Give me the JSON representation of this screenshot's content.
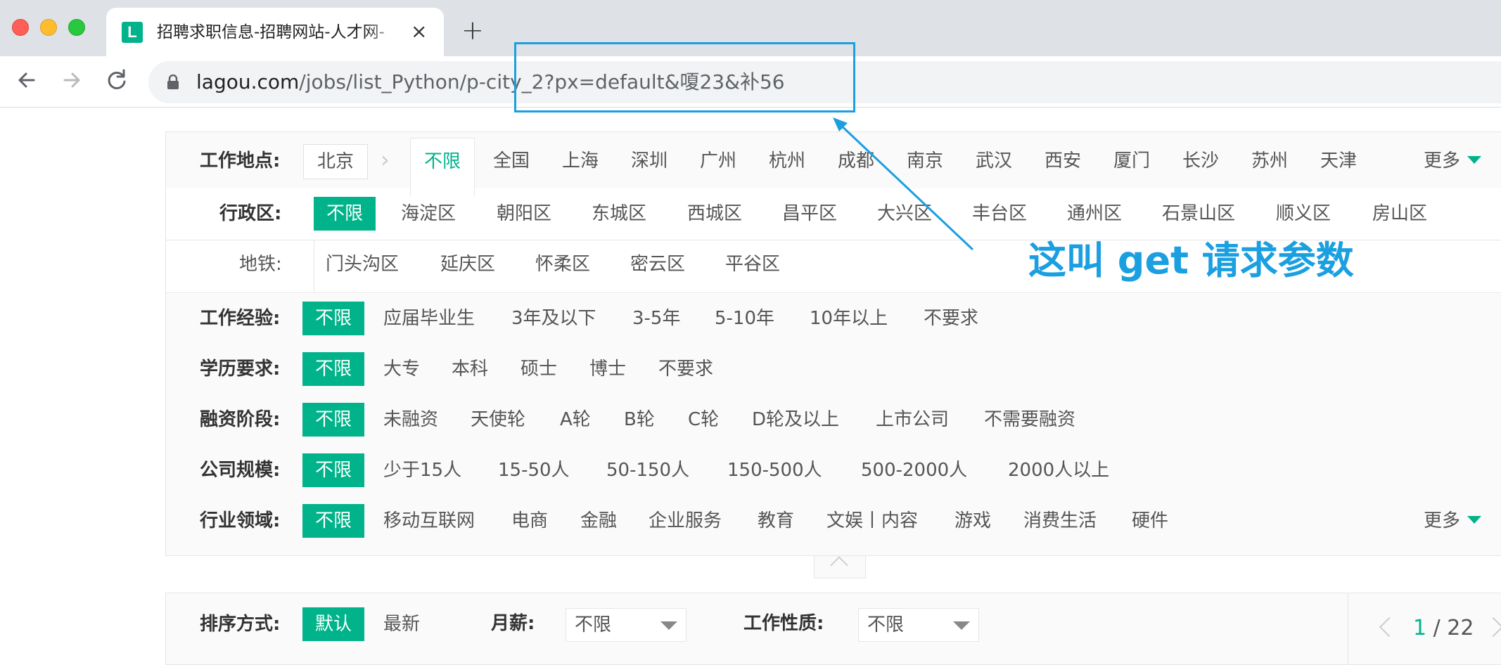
{
  "browser": {
    "tab_title": "招聘求职信息-招聘网站-人才网-",
    "favicon_letter": "L",
    "tab_close": "×",
    "new_tab": "+",
    "url_host": "lagou.com",
    "url_path": "/jobs/list_Python/p-city_2?px=default&嗄23&补56"
  },
  "filters": {
    "location": {
      "label": "工作地点:",
      "current_city": "北京",
      "unlimited": "不限",
      "cities": [
        "全国",
        "上海",
        "深圳",
        "广州",
        "杭州",
        "成都",
        "南京",
        "武汉",
        "西安",
        "厦门",
        "长沙",
        "苏州",
        "天津"
      ],
      "more": "更多"
    },
    "district": {
      "label": "行政区:",
      "active": "不限",
      "row1": [
        "海淀区",
        "朝阳区",
        "东城区",
        "西城区",
        "昌平区",
        "大兴区",
        "丰台区",
        "通州区",
        "石景山区",
        "顺义区",
        "房山区"
      ],
      "subway_label": "地铁:",
      "row2": [
        "门头沟区",
        "延庆区",
        "怀柔区",
        "密云区",
        "平谷区"
      ]
    },
    "experience": {
      "label": "工作经验:",
      "active": "不限",
      "options": [
        "应届毕业生",
        "3年及以下",
        "3-5年",
        "5-10年",
        "10年以上",
        "不要求"
      ]
    },
    "education": {
      "label": "学历要求:",
      "active": "不限",
      "options": [
        "大专",
        "本科",
        "硕士",
        "博士",
        "不要求"
      ]
    },
    "financing": {
      "label": "融资阶段:",
      "active": "不限",
      "options": [
        "未融资",
        "天使轮",
        "A轮",
        "B轮",
        "C轮",
        "D轮及以上",
        "上市公司",
        "不需要融资"
      ]
    },
    "company_size": {
      "label": "公司规模:",
      "active": "不限",
      "options": [
        "少于15人",
        "15-50人",
        "50-150人",
        "150-500人",
        "500-2000人",
        "2000人以上"
      ]
    },
    "industry": {
      "label": "行业领域:",
      "active": "不限",
      "options": [
        "移动互联网",
        "电商",
        "金融",
        "企业服务",
        "教育",
        "文娱丨内容",
        "游戏",
        "消费生活",
        "硬件"
      ],
      "more": "更多"
    }
  },
  "sortbar": {
    "sort_label": "排序方式:",
    "sort_default": "默认",
    "sort_latest": "最新",
    "salary_label": "月薪:",
    "salary_value": "不限",
    "nature_label": "工作性质:",
    "nature_value": "不限",
    "page_current": "1",
    "page_total": "/ 22"
  },
  "annotation": {
    "text": "这叫 get 请求参数",
    "color": "#1a9fe0"
  },
  "colors": {
    "accent": "#00b38a",
    "annotation": "#1a9fe0"
  }
}
